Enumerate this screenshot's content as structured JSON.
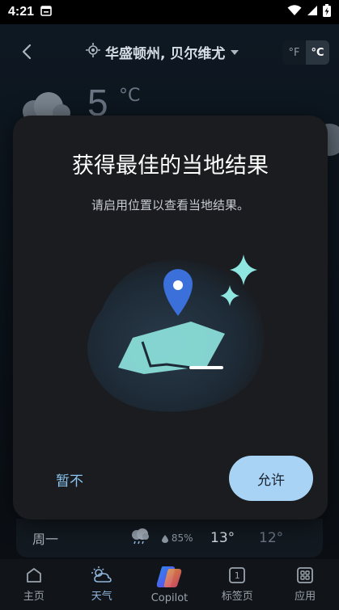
{
  "status": {
    "time": "4:21",
    "icons": [
      "calendar-icon",
      "wifi-icon",
      "signal-icon",
      "battery-charging-icon"
    ]
  },
  "header": {
    "location": "华盛顿州, 贝尔维尤",
    "unit_f": "°F",
    "unit_c": "°C",
    "selected_unit": "°C"
  },
  "background": {
    "temp": "5",
    "temp_unit": "°C",
    "forecast_row": {
      "day": "周一",
      "humidity": "85%",
      "high": "13°",
      "low": "12°"
    }
  },
  "dialog": {
    "title": "获得最佳的当地结果",
    "subtitle": "请启用位置以查看当地结果。",
    "deny_label": "暂不",
    "allow_label": "允许"
  },
  "nav": {
    "items": [
      {
        "label": "主页",
        "icon": "home-icon"
      },
      {
        "label": "天气",
        "icon": "weather-icon",
        "active": true
      },
      {
        "label": "Copilot",
        "icon": "copilot-icon"
      },
      {
        "label": "标签页",
        "icon": "tabs-icon",
        "count": "1"
      },
      {
        "label": "应用",
        "icon": "apps-icon"
      }
    ]
  },
  "colors": {
    "accent": "#a8d3f4",
    "dialog_bg": "#1a1c20",
    "pin": "#3b6fd9",
    "sparkle": "#8fe6e0"
  }
}
